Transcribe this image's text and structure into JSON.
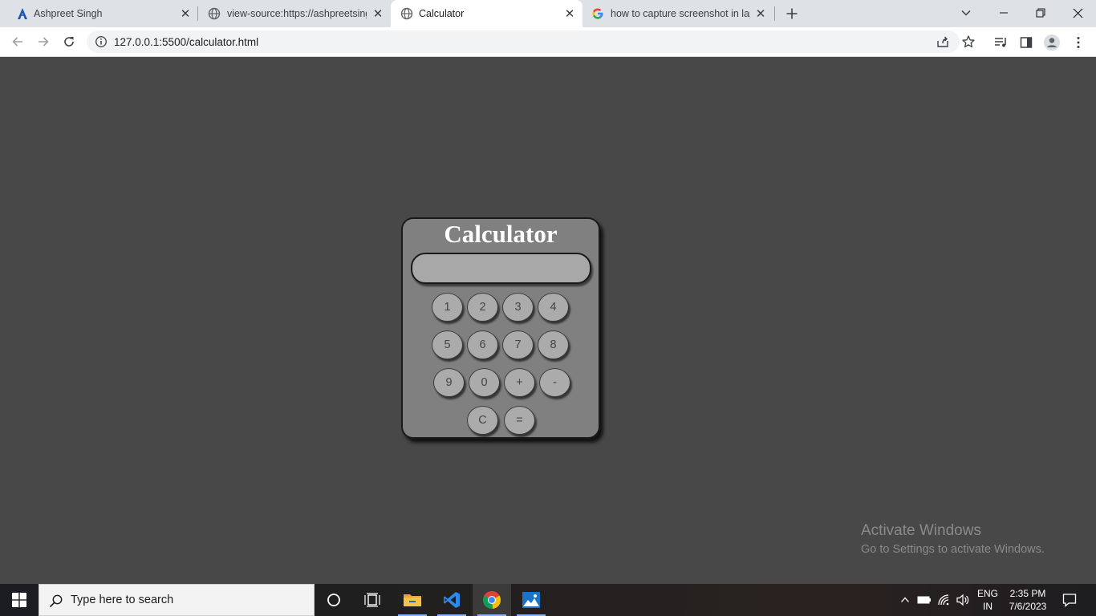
{
  "browser": {
    "tabs": [
      {
        "title": "Ashpreet Singh",
        "icon": "a-logo-icon"
      },
      {
        "title": "view-source:https://ashpreetsing",
        "icon": "globe-icon"
      },
      {
        "title": "Calculator",
        "icon": "globe-icon",
        "active": true
      },
      {
        "title": "how to capture screenshot in lap",
        "icon": "google-g-icon"
      }
    ],
    "url": "127.0.0.1:5500/calculator.html"
  },
  "calculator": {
    "title": "Calculator",
    "display_value": "",
    "keys": [
      "1",
      "2",
      "3",
      "4",
      "5",
      "6",
      "7",
      "8",
      "9",
      "0",
      "+",
      "-",
      "C",
      "="
    ]
  },
  "watermark": {
    "line1": "Activate Windows",
    "line2": "Go to Settings to activate Windows."
  },
  "taskbar": {
    "search_placeholder": "Type here to search",
    "language": "ENG",
    "region": "IN",
    "time": "2:35 PM",
    "date": "7/6/2023"
  },
  "colors": {
    "page_background": "#484848",
    "calculator_body": "#808080",
    "key_fill": "#ababab",
    "title_text": "#ffffff"
  }
}
